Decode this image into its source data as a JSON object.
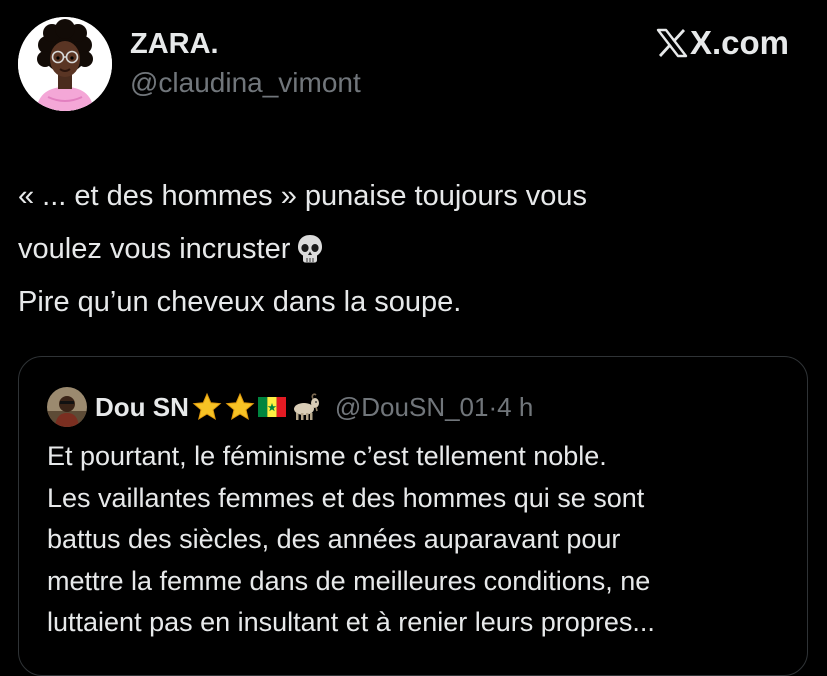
{
  "post": {
    "author": {
      "display_name": "ZARA.",
      "handle": "@claudina_vimont",
      "avatar": "cartoon-woman-avatar"
    },
    "brand": "X.com",
    "brand_icon": "x-logo-icon",
    "text_lines": [
      "« ... et des hommes » punaise toujours vous",
      "voulez vous incruster",
      "Pire qu’un cheveux dans la soupe."
    ],
    "emoji": "skull-icon"
  },
  "quoted_post": {
    "author": {
      "display_name": "Dou SN",
      "name_emojis": [
        "star-icon",
        "star-icon",
        "senegal-flag-icon",
        "goat-icon"
      ],
      "handle": "@DouSN_01",
      "separator": "·",
      "time": "4 h"
    },
    "text_lines": [
      "Et pourtant, le féminisme c’est tellement noble.",
      "Les vaillantes femmes et des hommes qui se sont",
      "battus des siècles, des années auparavant pour",
      "mettre la femme dans de meilleures conditions, ne",
      "luttaient pas en insultant et à renier leurs propres..."
    ]
  },
  "colors": {
    "background": "#000000",
    "text_primary": "#e7e9ea",
    "text_secondary": "#71767b",
    "border": "#2f3336"
  }
}
